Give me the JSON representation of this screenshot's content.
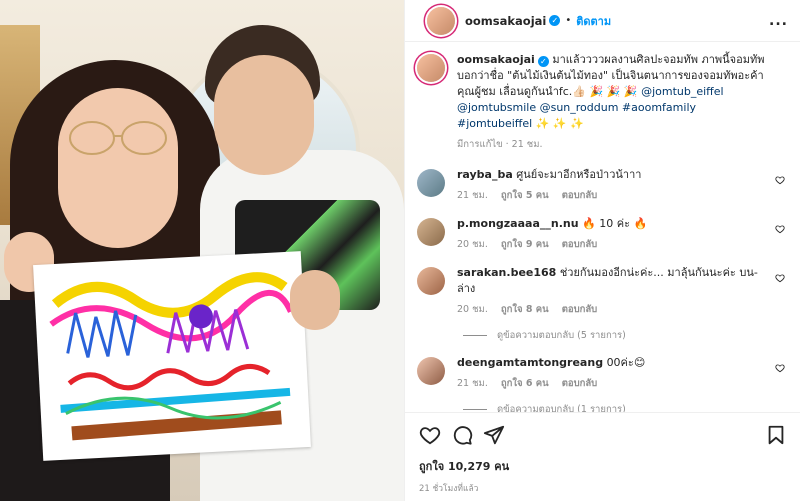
{
  "post": {
    "username": "oomsakaojai",
    "follow_label": "ติดตาม",
    "more_label": "...",
    "separator": "•"
  },
  "caption": {
    "username": "oomsakaojai",
    "text": "มาแล้ววววผลงานศิลปะจอมทัพ ภาพนี้จอมทัพบอกว่าชื่อ \"ต้นไม้เงินต้นไม้ทอง\" เป็นจินตนาการของจอมทัพอะค้าคุณผู้ชม เลื่อนดูกันนำfc.👍🏻 🎉 🎉 🎉",
    "mentions": "@jomtub_eiffel @jomtubsmile @sun_roddum #aoomfamily #jomtubeiffel ✨ ✨ ✨",
    "meta": "มีการแก้ไข · 21 ชม."
  },
  "comments": [
    {
      "username": "rayba_ba",
      "text": "ศูนย์จะมาอีกหรือป่าวน้าาา",
      "time": "21 ชม.",
      "likes": "ถูกใจ 5 คน",
      "reply": "ตอบกลับ"
    },
    {
      "username": "p.mongzaaaa__n.nu",
      "text": "🔥 10 ค่ะ 🔥",
      "time": "20 ชม.",
      "likes": "ถูกใจ 9 คน",
      "reply": "ตอบกลับ"
    },
    {
      "username": "sarakan.bee168",
      "text": "ช่วยกันมองอีกน่ะค่ะ... มาลุ้นกันนะค่ะ บน-ล่าง",
      "time": "20 ชม.",
      "likes": "ถูกใจ 8 คน",
      "reply": "ตอบกลับ",
      "view_replies": "ดูข้อความตอบกลับ (5 รายการ)"
    },
    {
      "username": "deengamtamtongreang",
      "text": "00ค่ะ😊",
      "time": "21 ชม.",
      "likes": "ถูกใจ 6 คน",
      "reply": "ตอบกลับ",
      "view_replies": "ดูข้อความตอบกลับ (1 รายการ)"
    }
  ],
  "footer": {
    "likes": "ถูกใจ 10,279 คน",
    "posted": "21 ชั่วโมงที่แล้ว"
  },
  "colors": {
    "accent": "#0095f6",
    "story_ring": "#d62976",
    "muted": "#8e8e8e"
  },
  "icons": [
    "heart-icon",
    "comment-icon",
    "share-icon",
    "bookmark-icon",
    "verified-badge-icon",
    "more-options-icon"
  ]
}
